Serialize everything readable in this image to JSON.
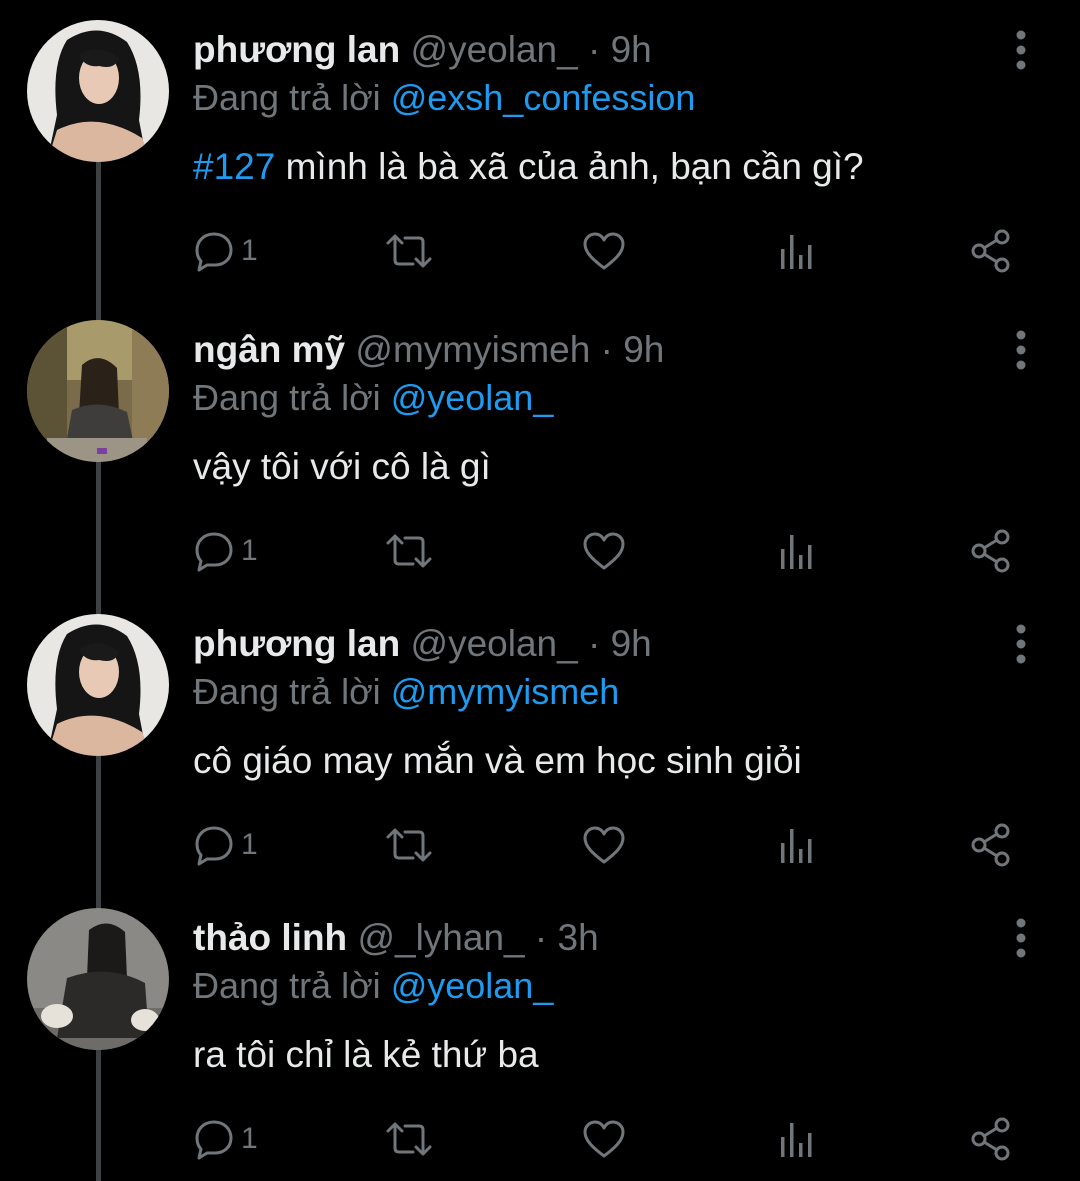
{
  "colors": {
    "background": "#000000",
    "text": "#e7e9ea",
    "muted": "#71767b",
    "accent": "#1d9bf0",
    "thread_line": "#3e4144"
  },
  "icons": [
    "more-vertical-icon",
    "reply-icon",
    "retweet-icon",
    "like-icon",
    "analytics-icon",
    "share-icon"
  ],
  "tweets": [
    {
      "name": "phương lan",
      "handle": "@yeolan_",
      "dot": "·",
      "time": "9h",
      "replying_prefix": "Đang trả lời",
      "replying_to": "@exsh_confession",
      "hashtag": "#127",
      "text": " mình là bà xã của ảnh, bạn cần gì?",
      "reply_count": "1"
    },
    {
      "name": "ngân mỹ",
      "handle": "@mymyismeh",
      "dot": "·",
      "time": "9h",
      "replying_prefix": "Đang trả lời",
      "replying_to": "@yeolan_",
      "hashtag": "",
      "text": "vậy tôi với cô là gì",
      "reply_count": "1"
    },
    {
      "name": "phương lan",
      "handle": "@yeolan_",
      "dot": "·",
      "time": "9h",
      "replying_prefix": "Đang trả lời",
      "replying_to": "@mymyismeh",
      "hashtag": "",
      "text": "cô giáo may mắn và em học sinh giỏi",
      "reply_count": "1"
    },
    {
      "name": "thảo linh",
      "handle": "@_lyhan_",
      "dot": "·",
      "time": "3h",
      "replying_prefix": "Đang trả lời",
      "replying_to": "@yeolan_",
      "hashtag": "",
      "text": "ra tôi chỉ là kẻ thứ ba",
      "reply_count": "1"
    }
  ]
}
